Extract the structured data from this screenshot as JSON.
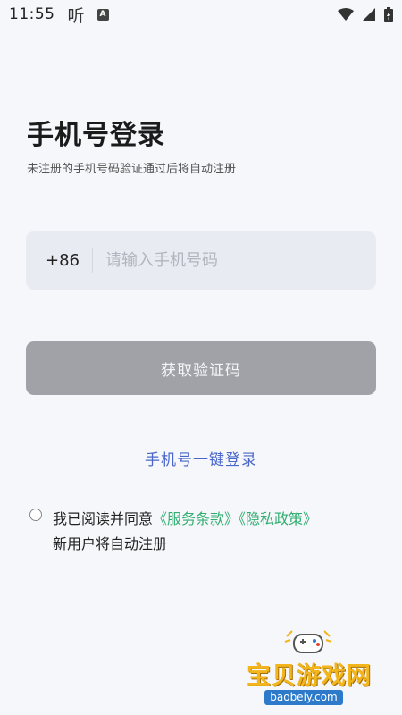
{
  "status_bar": {
    "time": "11:55",
    "listen_glyph": "听",
    "app_badge": "A"
  },
  "login": {
    "title": "手机号登录",
    "subtitle": "未注册的手机号码验证通过后将自动注册",
    "country_code": "+86",
    "phone_placeholder": "请输入手机号码",
    "get_code_label": "获取验证码",
    "one_key_login_label": "手机号一键登录"
  },
  "agreement": {
    "prefix": "我已阅读并同意",
    "terms_link": "《服务条款》",
    "privacy_link": "《隐私政策》",
    "note": "新用户将自动注册",
    "checked": false
  },
  "watermark": {
    "brand": "宝贝游戏网",
    "url": "baobeiy.com"
  },
  "colors": {
    "background": "#f6f7fb",
    "input_bg": "#e9ebf2",
    "button_disabled": "#a0a2a7",
    "link_blue": "#4a67c9",
    "link_green": "#2fae6f",
    "brand_yellow": "#f2b51b"
  },
  "icons": {
    "wifi": "wifi-icon",
    "signal": "signal-icon",
    "battery": "battery-icon",
    "controller": "gamepad-icon"
  }
}
